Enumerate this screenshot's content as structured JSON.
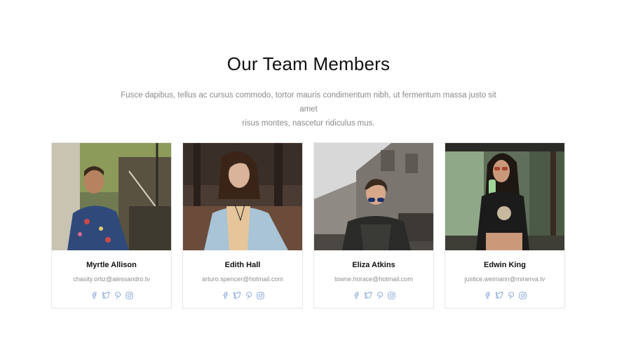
{
  "section": {
    "title": "Our Team Members",
    "subtitle_line1": "Fusce dapibus, tellus ac cursus commodo, tortor mauris condimentum nibh, ut fermentum massa justo sit amet",
    "subtitle_line2": "risus montes, nascetur ridiculus mus."
  },
  "members": [
    {
      "name": "Myrtle Allison",
      "email": "chasity.ortiz@alessandro.tv"
    },
    {
      "name": "Edith Hall",
      "email": "arturo.spencer@hotmail.com"
    },
    {
      "name": "Eliza Atkins",
      "email": "towne.horace@hotmail.com"
    },
    {
      "name": "Edwin King",
      "email": "justice.weimann@minerva.tv"
    }
  ],
  "social_icons": [
    "facebook-icon",
    "twitter-icon",
    "pinterest-icon",
    "instagram-icon"
  ],
  "colors": {
    "icon": "#7d9fd6",
    "muted_text": "#8a8a8a",
    "border": "#e6e6e6"
  }
}
